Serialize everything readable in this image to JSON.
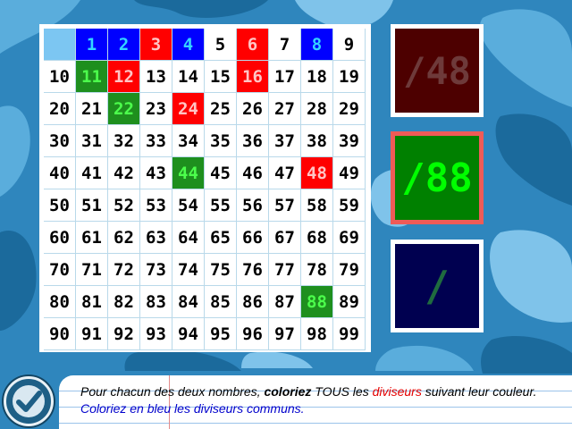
{
  "grid": {
    "cells": [
      {
        "label": "",
        "color": "blank"
      },
      {
        "label": "1",
        "color": "blue"
      },
      {
        "label": "2",
        "color": "blue"
      },
      {
        "label": "3",
        "color": "red"
      },
      {
        "label": "4",
        "color": "blue"
      },
      {
        "label": "5",
        "color": ""
      },
      {
        "label": "6",
        "color": "red"
      },
      {
        "label": "7",
        "color": ""
      },
      {
        "label": "8",
        "color": "blue"
      },
      {
        "label": "9",
        "color": ""
      },
      {
        "label": "10",
        "color": ""
      },
      {
        "label": "11",
        "color": "green"
      },
      {
        "label": "12",
        "color": "red"
      },
      {
        "label": "13",
        "color": ""
      },
      {
        "label": "14",
        "color": ""
      },
      {
        "label": "15",
        "color": ""
      },
      {
        "label": "16",
        "color": "red"
      },
      {
        "label": "17",
        "color": ""
      },
      {
        "label": "18",
        "color": ""
      },
      {
        "label": "19",
        "color": ""
      },
      {
        "label": "20",
        "color": ""
      },
      {
        "label": "21",
        "color": ""
      },
      {
        "label": "22",
        "color": "green"
      },
      {
        "label": "23",
        "color": ""
      },
      {
        "label": "24",
        "color": "red"
      },
      {
        "label": "25",
        "color": ""
      },
      {
        "label": "26",
        "color": ""
      },
      {
        "label": "27",
        "color": ""
      },
      {
        "label": "28",
        "color": ""
      },
      {
        "label": "29",
        "color": ""
      },
      {
        "label": "30",
        "color": ""
      },
      {
        "label": "31",
        "color": ""
      },
      {
        "label": "32",
        "color": ""
      },
      {
        "label": "33",
        "color": ""
      },
      {
        "label": "34",
        "color": ""
      },
      {
        "label": "35",
        "color": ""
      },
      {
        "label": "36",
        "color": ""
      },
      {
        "label": "37",
        "color": ""
      },
      {
        "label": "38",
        "color": ""
      },
      {
        "label": "39",
        "color": ""
      },
      {
        "label": "40",
        "color": ""
      },
      {
        "label": "41",
        "color": ""
      },
      {
        "label": "42",
        "color": ""
      },
      {
        "label": "43",
        "color": ""
      },
      {
        "label": "44",
        "color": "green"
      },
      {
        "label": "45",
        "color": ""
      },
      {
        "label": "46",
        "color": ""
      },
      {
        "label": "47",
        "color": ""
      },
      {
        "label": "48",
        "color": "red"
      },
      {
        "label": "49",
        "color": ""
      },
      {
        "label": "50",
        "color": ""
      },
      {
        "label": "51",
        "color": ""
      },
      {
        "label": "52",
        "color": ""
      },
      {
        "label": "53",
        "color": ""
      },
      {
        "label": "54",
        "color": ""
      },
      {
        "label": "55",
        "color": ""
      },
      {
        "label": "56",
        "color": ""
      },
      {
        "label": "57",
        "color": ""
      },
      {
        "label": "58",
        "color": ""
      },
      {
        "label": "59",
        "color": ""
      },
      {
        "label": "60",
        "color": ""
      },
      {
        "label": "61",
        "color": ""
      },
      {
        "label": "62",
        "color": ""
      },
      {
        "label": "63",
        "color": ""
      },
      {
        "label": "64",
        "color": ""
      },
      {
        "label": "65",
        "color": ""
      },
      {
        "label": "66",
        "color": ""
      },
      {
        "label": "67",
        "color": ""
      },
      {
        "label": "68",
        "color": ""
      },
      {
        "label": "69",
        "color": ""
      },
      {
        "label": "70",
        "color": ""
      },
      {
        "label": "71",
        "color": ""
      },
      {
        "label": "72",
        "color": ""
      },
      {
        "label": "73",
        "color": ""
      },
      {
        "label": "74",
        "color": ""
      },
      {
        "label": "75",
        "color": ""
      },
      {
        "label": "76",
        "color": ""
      },
      {
        "label": "77",
        "color": ""
      },
      {
        "label": "78",
        "color": ""
      },
      {
        "label": "79",
        "color": ""
      },
      {
        "label": "80",
        "color": ""
      },
      {
        "label": "81",
        "color": ""
      },
      {
        "label": "82",
        "color": ""
      },
      {
        "label": "83",
        "color": ""
      },
      {
        "label": "84",
        "color": ""
      },
      {
        "label": "85",
        "color": ""
      },
      {
        "label": "86",
        "color": ""
      },
      {
        "label": "87",
        "color": ""
      },
      {
        "label": "88",
        "color": "green"
      },
      {
        "label": "89",
        "color": ""
      },
      {
        "label": "90",
        "color": ""
      },
      {
        "label": "91",
        "color": ""
      },
      {
        "label": "92",
        "color": ""
      },
      {
        "label": "93",
        "color": ""
      },
      {
        "label": "94",
        "color": ""
      },
      {
        "label": "95",
        "color": ""
      },
      {
        "label": "96",
        "color": ""
      },
      {
        "label": "97",
        "color": ""
      },
      {
        "label": "98",
        "color": ""
      },
      {
        "label": "99",
        "color": ""
      }
    ]
  },
  "boxes": [
    {
      "label": "/48",
      "background": "#4d0000",
      "text_color": "#6e3a3a"
    },
    {
      "label": "/88",
      "background": "#008000",
      "text_color": "#00ff00"
    },
    {
      "label": "/",
      "background": "#000050",
      "text_color": "#1f6b3f"
    }
  ],
  "instruction": {
    "part1": "Pour chacun des deux nombres, ",
    "part2": "coloriez",
    "part3": " TOUS les ",
    "part4": "diviseurs",
    "part5": " suivant leur couleur. ",
    "part6": "Coloriez en bleu les diviseurs communs."
  },
  "check_button": {
    "icon": "check-icon"
  },
  "colors": {
    "background": "#2f86bd",
    "blue_cell": "#0000ff",
    "red_cell": "#ff0000",
    "green_cell": "#1e8f1e"
  }
}
